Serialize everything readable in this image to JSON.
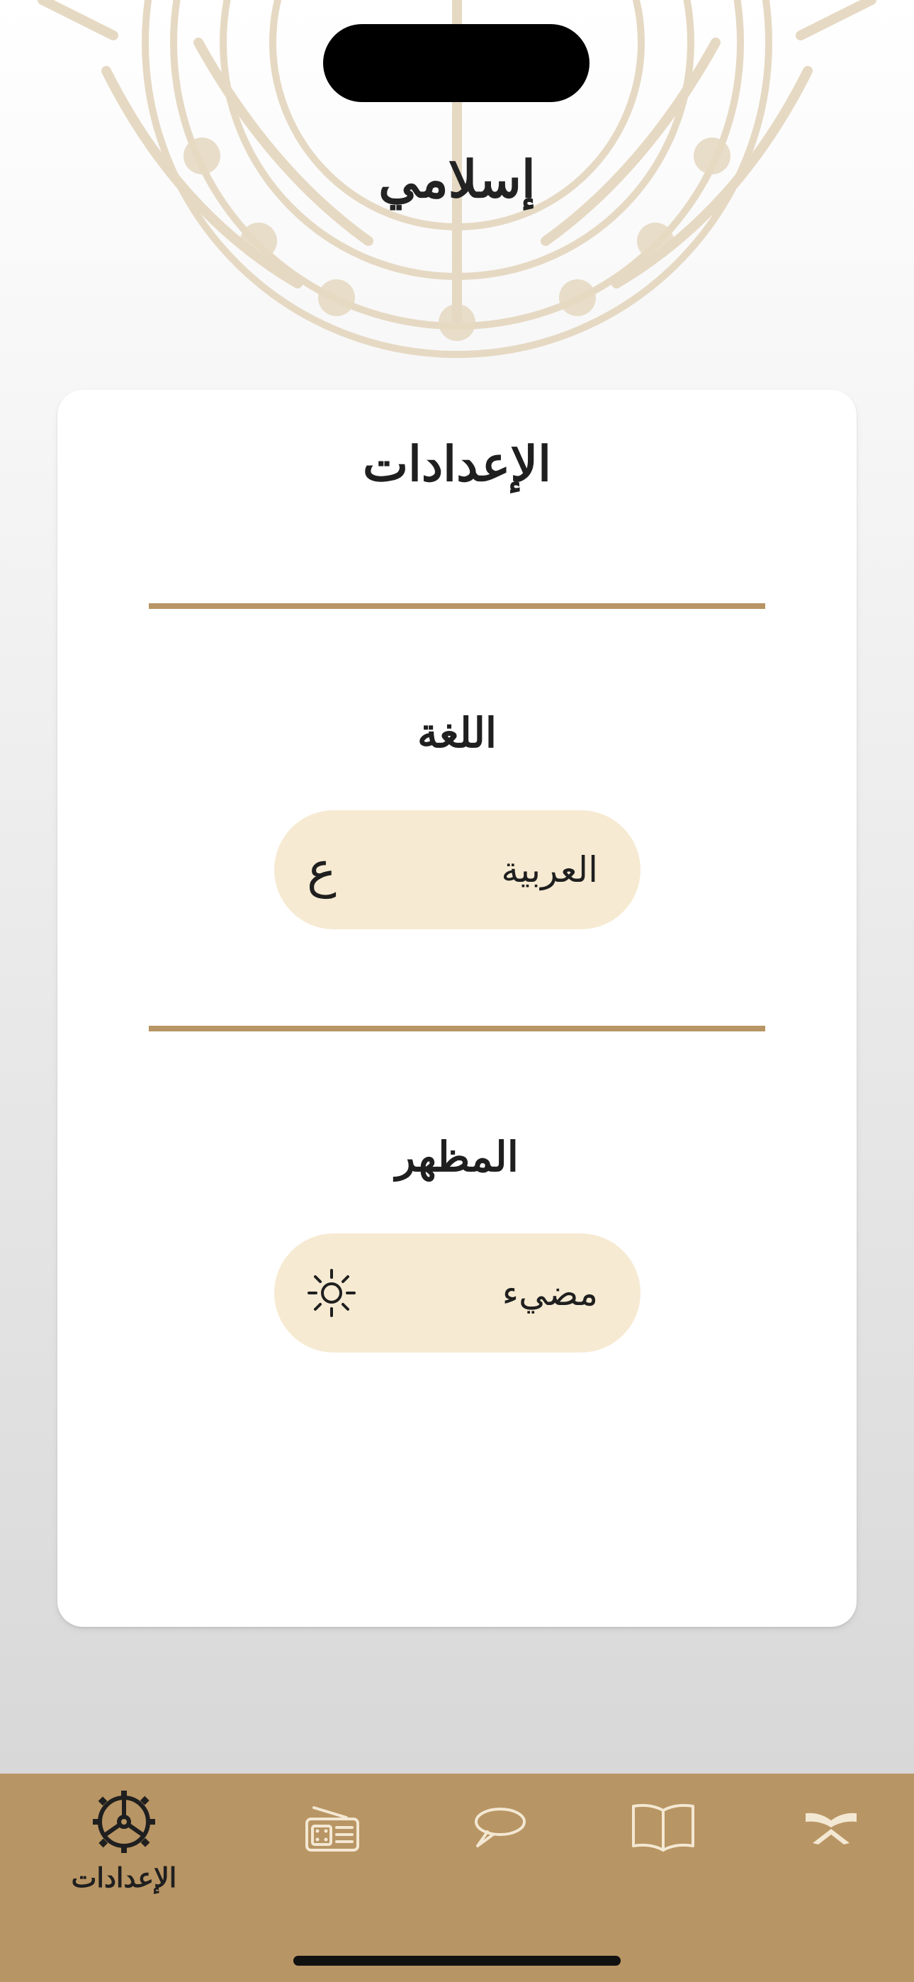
{
  "app": {
    "title": "إسلامي"
  },
  "settings_card": {
    "title": "الإعدادات",
    "language": {
      "title": "اللغة",
      "value": "العربية",
      "icon_glyph": "ع",
      "icon_name": "arabic-letter-icon"
    },
    "appearance": {
      "title": "المظهر",
      "value": "مضيء",
      "icon_name": "sun-icon"
    }
  },
  "tabbar": {
    "items": [
      {
        "id": "settings",
        "label": "الإعدادات",
        "icon": "gear-icon",
        "active": true
      },
      {
        "id": "radio",
        "label": "",
        "icon": "radio-icon",
        "active": false
      },
      {
        "id": "tasbeh",
        "label": "",
        "icon": "speech-bubble-icon",
        "active": false
      },
      {
        "id": "hadith",
        "label": "",
        "icon": "open-book-icon",
        "active": false
      },
      {
        "id": "quran",
        "label": "",
        "icon": "quran-stand-icon",
        "active": false
      }
    ]
  },
  "colors": {
    "accent": "#B89564",
    "pill_background": "#F6EAD2",
    "active_icon": "#1F1F1F",
    "inactive_icon": "#F3E8D3",
    "mandala": "#E6D9C3"
  }
}
